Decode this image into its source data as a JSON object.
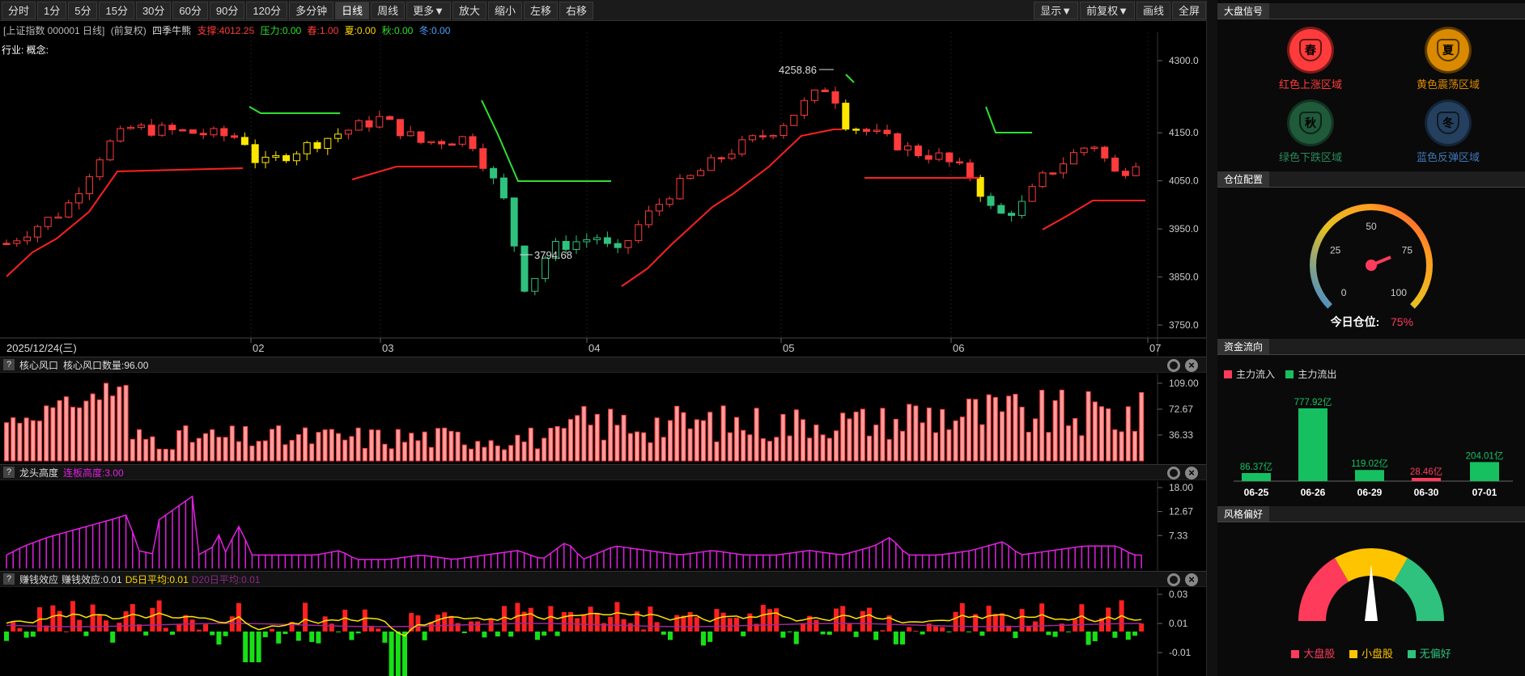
{
  "toolbar": {
    "buttons": [
      "分时",
      "1分",
      "5分",
      "15分",
      "30分",
      "60分",
      "90分",
      "120分",
      "多分钟",
      "日线",
      "周线",
      "更多▼",
      "放大",
      "缩小",
      "左移",
      "右移"
    ],
    "active": "日线",
    "right_buttons": [
      "显示▼",
      "前复权▼",
      "画线",
      "全屏"
    ]
  },
  "infoline": {
    "title": "[上证指数 000001 日线]",
    "fq": "(前复权)",
    "indicator": "四季牛熊",
    "support": "支撑:4012.25",
    "pressure": "压力:0.00",
    "spring": "春:1.00",
    "summer": "夏:0.00",
    "autumn": "秋:0.00",
    "winter": "冬:0.00",
    "hangye": "行业: 概念:"
  },
  "main_chart": {
    "yticks": [
      "4300.0",
      "4150.0",
      "4050.0",
      "3950.0",
      "3850.0",
      "3750.0"
    ],
    "date_label": "2025/12/24(三)",
    "xticks": [
      "02",
      "03",
      "04",
      "05",
      "06",
      "07"
    ],
    "high_label": "4258.86",
    "low_label": "3794.68"
  },
  "panel1": {
    "name": "核心风口",
    "value": "核心风口数量:96.00",
    "yticks": [
      "109.00",
      "72.67",
      "36.33"
    ]
  },
  "panel2": {
    "name": "龙头高度",
    "value": "连板高度:3.00",
    "yticks": [
      "18.00",
      "12.67",
      "7.33"
    ]
  },
  "panel3": {
    "name": "赚钱效应",
    "value": "赚钱效应:0.01",
    "d5": "D5日平均:0.01",
    "d20": "D20日平均:0.01",
    "yticks": [
      "0.03",
      "0.01",
      "-0.01"
    ]
  },
  "sidebar": {
    "signal_title": "大盘信号",
    "signals": [
      {
        "glyph": "春",
        "label": "红色上涨区域",
        "color": "#ff3b3b"
      },
      {
        "glyph": "夏",
        "label": "黄色震荡区域",
        "color": "#d98a00"
      },
      {
        "glyph": "秋",
        "label": "绿色下跌区域",
        "color": "#1f5a3a"
      },
      {
        "glyph": "冬",
        "label": "蓝色反弹区域",
        "color": "#24405e"
      }
    ],
    "position_title": "仓位配置",
    "gauge_ticks": [
      "0",
      "25",
      "50",
      "75",
      "100"
    ],
    "position_label": "今日仓位:",
    "position_value": "75%",
    "position_percent": 75,
    "flow_title": "资金流向",
    "flow_legend_in": "主力流入",
    "flow_legend_out": "主力流出",
    "flow": [
      {
        "date": "06-25",
        "value": 86.37,
        "label": "86.37亿",
        "dir": "out"
      },
      {
        "date": "06-26",
        "value": 777.92,
        "label": "777.92亿",
        "dir": "out"
      },
      {
        "date": "06-29",
        "value": 119.02,
        "label": "119.02亿",
        "dir": "out"
      },
      {
        "date": "06-30",
        "value": 28.46,
        "label": "28.46亿",
        "dir": "in"
      },
      {
        "date": "07-01",
        "value": 204.01,
        "label": "204.01亿",
        "dir": "out"
      }
    ],
    "style_title": "风格偏好",
    "style_legend": [
      "大盘股",
      "小盘股",
      "无偏好"
    ]
  }
}
